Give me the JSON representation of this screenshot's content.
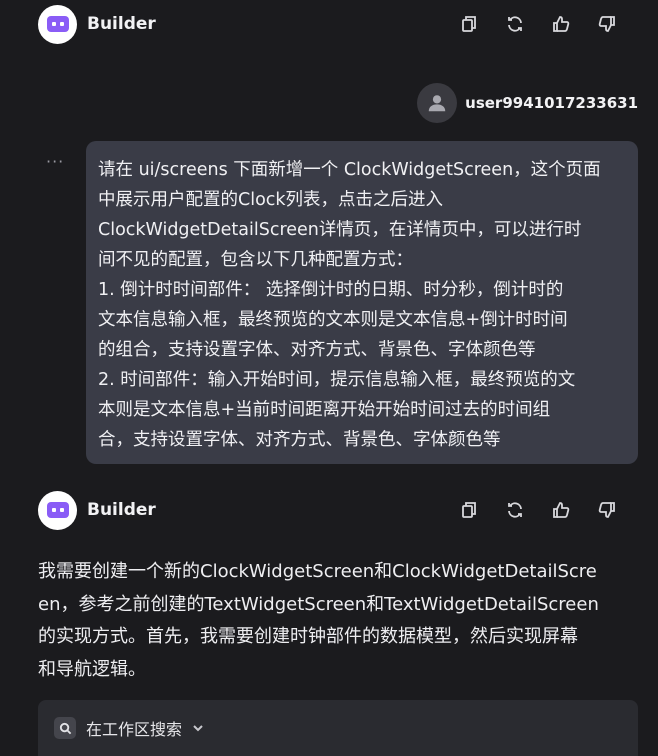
{
  "messages": [
    {
      "role": "bot",
      "name": "Builder"
    },
    {
      "role": "user",
      "name": "user9941017233631",
      "more_label": "···",
      "lines": [
        "请在 ui/screens 下面新增一个 ClockWidgetScreen，这个页面",
        "中展示用户配置的Clock列表，点击之后进入",
        "ClockWidgetDetailScreen详情页，在详情页中，可以进行时",
        "间不见的配置，包含以下几种配置方式：",
        "1. 倒计时时间部件： 选择倒计时的日期、时分秒，倒计时的",
        "文本信息输入框，最终预览的文本则是文本信息+倒计时时间",
        "的组合，支持设置字体、对齐方式、背景色、字体颜色等",
        "2. 时间部件：输入开始时间，提示信息输入框，最终预览的文",
        "本则是文本信息+当前时间距离开始开始时间过去的时间组",
        "合，支持设置字体、对齐方式、背景色、字体颜色等"
      ]
    },
    {
      "role": "bot",
      "name": "Builder",
      "lines": [
        "我需要创建一个新的ClockWidgetScreen和ClockWidgetDetailScre",
        "en，参考之前创建的TextWidgetScreen和TextWidgetDetailScreen",
        "的实现方式。首先，我需要创建时钟部件的数据模型，然后实现屏幕",
        "和导航逻辑。"
      ]
    }
  ],
  "search_chip": {
    "label": "在工作区搜索",
    "icon": "search-icon"
  },
  "action_icons": [
    "copy-icon",
    "regenerate-icon",
    "thumbs-up-icon",
    "thumbs-down-icon"
  ],
  "colors": {
    "background": "#1b1b1e",
    "user_bubble": "#3a3c47",
    "bot_avatar_accent": "#8a5cf6"
  }
}
